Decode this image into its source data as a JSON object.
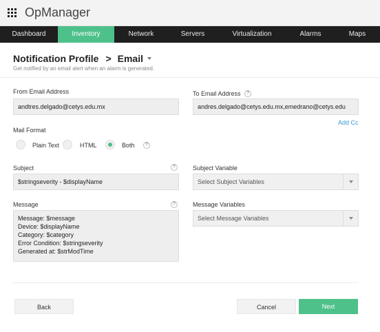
{
  "app": {
    "title": "OpManager"
  },
  "nav": {
    "items": [
      {
        "label": "Dashboard",
        "active": false
      },
      {
        "label": "Inventory",
        "active": true
      },
      {
        "label": "Network",
        "active": false
      },
      {
        "label": "Servers",
        "active": false
      },
      {
        "label": "Virtualization",
        "active": false
      },
      {
        "label": "Alarms",
        "active": false
      },
      {
        "label": "Maps",
        "active": false
      }
    ]
  },
  "header": {
    "title": "Notification Profile",
    "separator": ">",
    "section": "Email",
    "subtitle": "Get notified by an email alert when an alarm is generated."
  },
  "form": {
    "from_label": "From Email Address",
    "from_value": "andtres.delgado@cetys.edu.mx",
    "to_label": "To Email Address",
    "to_value": "andres.delgado@cetys.edu.mx,emedrano@cetys.edu",
    "add_cc": "Add Cc",
    "mail_format_label": "Mail Format",
    "mail_format_options": [
      "Plain Text",
      "HTML",
      "Both"
    ],
    "mail_format_selected": "Both",
    "subject_label": "Subject",
    "subject_value": "$stringseverity - $displayName",
    "subject_variable_label": "Subject Variable",
    "subject_variable_placeholder": "Select Subject Variables",
    "message_label": "Message",
    "message_lines": [
      "Message: $message",
      "Device: $displayName",
      "Category: $category",
      "Error Condition: $stringseverity",
      "Generated at: $strModTime"
    ],
    "message_variables_label": "Message Variables",
    "message_variables_placeholder": "Select Message Variables",
    "help_glyph": "?"
  },
  "footer": {
    "back": "Back",
    "cancel": "Cancel",
    "next": "Next"
  },
  "colors": {
    "accent": "#4ec18b",
    "nav_bg": "#1f1f1f",
    "link": "#3a9ad9"
  }
}
